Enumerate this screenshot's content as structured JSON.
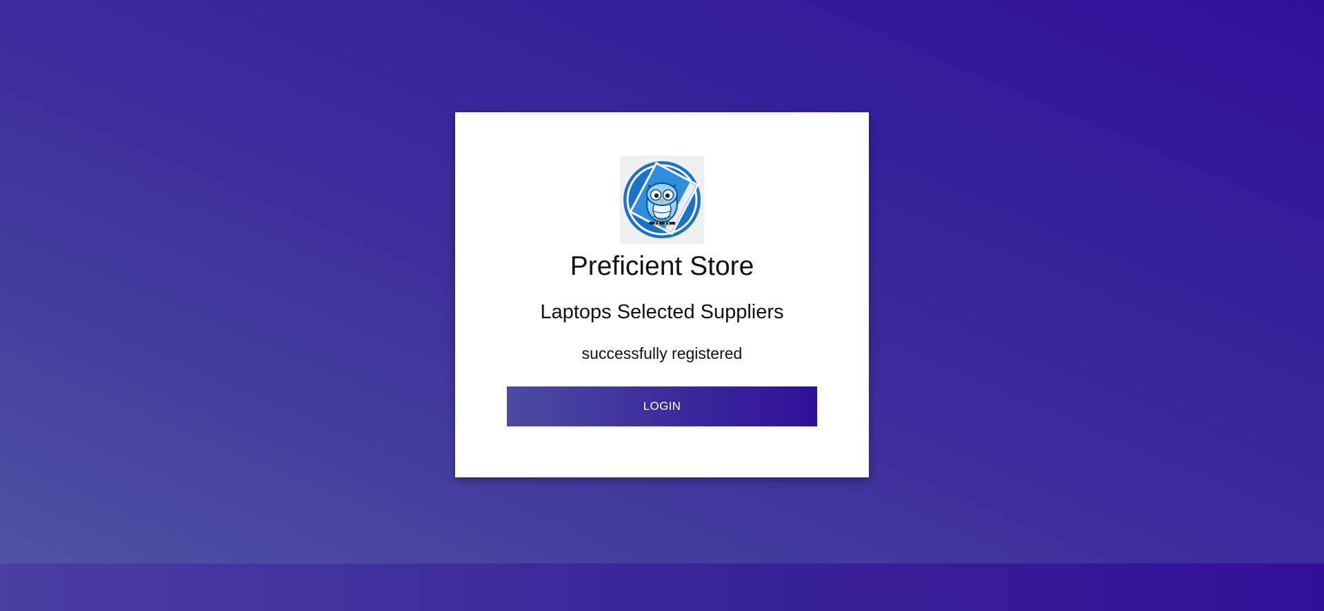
{
  "store": {
    "title": "Preficient Store",
    "subtitle": "Laptops Selected Suppliers",
    "message": "successfully registered",
    "logo_icon": "owl-logo-icon"
  },
  "actions": {
    "login_label": "LOGIN"
  },
  "colors": {
    "gradient_start": "#4f52a3",
    "gradient_end": "#30109a",
    "card_background": "#ffffff",
    "logo_blue": "#1a73c8"
  }
}
